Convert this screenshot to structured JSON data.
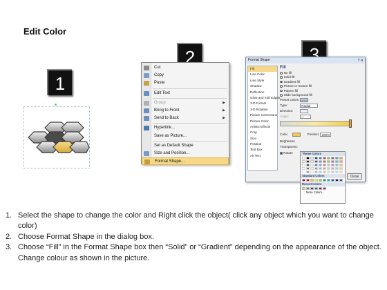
{
  "page": {
    "title": "Edit Color"
  },
  "steps": [
    "1",
    "2",
    "3"
  ],
  "context_menu": {
    "items": [
      {
        "label": "Cut",
        "icon": "scissors-icon",
        "icon_color": "#8a8a8a",
        "submenu": false,
        "disabled": false
      },
      {
        "label": "Copy",
        "icon": "copy-icon",
        "icon_color": "#7a9cc8",
        "submenu": false,
        "disabled": false
      },
      {
        "label": "Paste",
        "icon": "paste-icon",
        "icon_color": "#c8a24a",
        "submenu": false,
        "disabled": false
      },
      {
        "sep": true
      },
      {
        "label": "Edit Text",
        "icon": "edit-text-icon",
        "icon_color": "#6a8fbf",
        "submenu": false,
        "disabled": false
      },
      {
        "sep": true
      },
      {
        "label": "Group",
        "icon": "group-icon",
        "icon_color": "#b0b0b0",
        "submenu": true,
        "disabled": true
      },
      {
        "label": "Bring to Front",
        "icon": "bring-front-icon",
        "icon_color": "#6a8fbf",
        "submenu": true,
        "disabled": false
      },
      {
        "label": "Send to Back",
        "icon": "send-back-icon",
        "icon_color": "#6a8fbf",
        "submenu": true,
        "disabled": false
      },
      {
        "sep": true
      },
      {
        "label": "Hyperlink...",
        "icon": "hyperlink-icon",
        "icon_color": "#4a7ab0",
        "submenu": false,
        "disabled": false
      },
      {
        "label": "Save as Picture...",
        "icon": "",
        "icon_color": "",
        "submenu": false,
        "disabled": false
      },
      {
        "sep": true
      },
      {
        "label": "Set as Default Shape",
        "icon": "",
        "icon_color": "",
        "submenu": false,
        "disabled": false
      },
      {
        "label": "Size and Position...",
        "icon": "size-position-icon",
        "icon_color": "#7a9cc8",
        "submenu": false,
        "disabled": false
      },
      {
        "label": "Format Shape...",
        "icon": "format-shape-icon",
        "icon_color": "#c89a3a",
        "submenu": false,
        "disabled": false,
        "highlighted": true
      }
    ]
  },
  "format_dialog": {
    "title": "Format Shape",
    "nav": [
      "Fill",
      "Line Color",
      "Line Style",
      "Shadow",
      "Reflection",
      "Glow and Soft Edges",
      "3-D Format",
      "3-D Rotation",
      "Picture Corrections",
      "Picture Color",
      "Artistic Effects",
      "Crop",
      "Size",
      "Position",
      "Text Box",
      "Alt Text"
    ],
    "selected_nav": "Fill",
    "heading": "Fill",
    "options": [
      "No fill",
      "Solid fill",
      "Gradient fill",
      "Picture or texture fill",
      "Pattern fill",
      "Slide background fill"
    ],
    "selected_option": "Gradient fill",
    "preset_label": "Preset colors:",
    "type_label": "Type:",
    "type_value": "Radial",
    "direction_label": "Direction:",
    "angle_label": "Angle:",
    "angle_value": "0°",
    "stops_label": "Gradient stops",
    "color_label": "Color",
    "position_label": "Position:",
    "position_value": "100%",
    "brightness_label": "Brightness",
    "transparency_label": "Transparenc",
    "rotate_label": "Rotate",
    "close_label": "Close"
  },
  "palette": {
    "theme_label": "Theme Colors",
    "standard_label": "Standard Colors",
    "recent_label": "Recent Colors",
    "more_label": "More Colors...",
    "theme_row": [
      "#ffffff",
      "#000000",
      "#eeece1",
      "#1f497d",
      "#4f81bd",
      "#c0504d",
      "#9bbb59",
      "#8064a2",
      "#4bacc6",
      "#f79646"
    ],
    "standard": [
      "#c00000",
      "#ff0000",
      "#ffc000",
      "#ffff00",
      "#92d050",
      "#00b050",
      "#00b0f0",
      "#0070c0",
      "#002060",
      "#7030a0"
    ],
    "recent": [
      "#f2c94c",
      "#7f7f7f",
      "#404040",
      "#0070c0",
      "#c00000",
      "#7030a0"
    ]
  },
  "instructions": [
    {
      "num": "1.",
      "text": "Select the shape to change the color and Right click the object( click any object which you want to change color)"
    },
    {
      "num": "2.",
      "text": "Choose Format Shape in the dialog box."
    },
    {
      "num": "3.",
      "text": "Choose “Fill” in the Format Shape box then “Solid” or “Gradient” depending on the appearance of the object. Change colour as shown in the picture."
    }
  ]
}
